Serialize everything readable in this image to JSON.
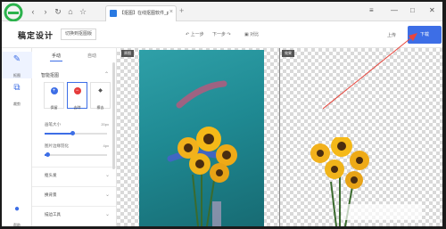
{
  "browser": {
    "tab_title": "【抠图】在线抠图软件_ps抠图...",
    "tab_close": "×",
    "new_tab": "+",
    "nav": {
      "back": "‹",
      "forward": "›",
      "refresh": "↻",
      "home": "⌂",
      "star": "☆"
    },
    "window_controls": {
      "menu": "≡",
      "minimize": "—",
      "maximize": "□",
      "close": "✕"
    }
  },
  "app": {
    "title": "稿定设计",
    "switch_button": "切换到抠图版",
    "toolbar": {
      "undo": "↶ 上一步",
      "redo": "下一步 ↷",
      "compare": "▣ 对比"
    },
    "upload": "上传",
    "download": "下载"
  },
  "rail": [
    {
      "icon": "magic-wand-icon",
      "label": "抠图"
    },
    {
      "icon": "crop-icon",
      "label": "裁剪"
    },
    {
      "icon": "help-icon",
      "label": "帮助"
    }
  ],
  "panel": {
    "tabs": [
      {
        "label": "手动"
      },
      {
        "label": "自动"
      }
    ],
    "section_title": "智能抠图",
    "tools": [
      {
        "label": "保留",
        "icon": "keep-icon",
        "color": "#3d6ee6",
        "glyph": "+"
      },
      {
        "label": "去除",
        "icon": "remove-icon",
        "color": "#e53b3b",
        "glyph": "−"
      },
      {
        "label": "擦去",
        "icon": "eraser-icon",
        "color": "#555555",
        "glyph": "◆"
      }
    ],
    "sliders": [
      {
        "label": "画笔大小",
        "value": "20px",
        "fill": 0.45
      },
      {
        "label": "图片边缘羽化",
        "value": "4px",
        "fill": 0.05
      }
    ],
    "collapsed_sections": [
      "抠头发",
      "换背景",
      "描边工具"
    ]
  },
  "canvas": {
    "left_tag": "原图",
    "right_tag": "效果"
  },
  "colors": {
    "accent": "#3d6ee6",
    "remove_red": "#e53b3b",
    "annotation_arrow": "#e8453c"
  }
}
